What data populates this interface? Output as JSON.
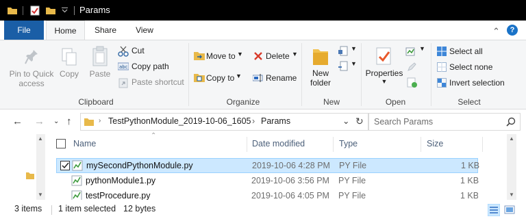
{
  "window": {
    "title": "Params",
    "quick_access_icons": [
      "folder-icon",
      "properties-checkmark-icon",
      "new-folder-icon",
      "customize-chevron-icon"
    ]
  },
  "tabs": [
    {
      "label": "File"
    },
    {
      "label": "Home"
    },
    {
      "label": "Share"
    },
    {
      "label": "View"
    }
  ],
  "ribbon": {
    "clipboard": {
      "pin_label": "Pin to Quick access",
      "pin_line1": "Pin to Quick",
      "pin_line2": "access",
      "copy": "Copy",
      "paste": "Paste",
      "cut": "Cut",
      "copy_path": "Copy path",
      "paste_shortcut": "Paste shortcut",
      "group": "Clipboard"
    },
    "organize": {
      "move_to": "Move to",
      "copy_to": "Copy to",
      "delete": "Delete",
      "rename": "Rename",
      "group": "Organize"
    },
    "new": {
      "new_folder_line1": "New",
      "new_folder_line2": "folder",
      "group": "New"
    },
    "open": {
      "properties": "Properties",
      "group": "Open"
    },
    "select": {
      "select_all": "Select all",
      "select_none": "Select none",
      "invert_selection": "Invert selection",
      "group": "Select"
    }
  },
  "address": {
    "crumbs": [
      "TestPythonModule_2019-10-06_1605",
      "Params"
    ],
    "search_placeholder": "Search Params"
  },
  "columns": {
    "name": "Name",
    "date": "Date modified",
    "type": "Type",
    "size": "Size"
  },
  "files": [
    {
      "name": "mySecondPythonModule.py",
      "date": "2019-10-06 4:28 PM",
      "type": "PY File",
      "size": "1 KB",
      "selected": true
    },
    {
      "name": "pythonModule1.py",
      "date": "2019-10-06 3:56 PM",
      "type": "PY File",
      "size": "1 KB",
      "selected": false
    },
    {
      "name": "testProcedure.py",
      "date": "2019-10-06 4:05 PM",
      "type": "PY File",
      "size": "1 KB",
      "selected": false
    }
  ],
  "status": {
    "items": "3 items",
    "selected": "1 item selected",
    "selected_size": "12 bytes"
  },
  "colors": {
    "file_tab": "#1a5ea6",
    "selection": "#cce8ff",
    "selection_border": "#99d1ff",
    "folder": "#e8b94a"
  }
}
